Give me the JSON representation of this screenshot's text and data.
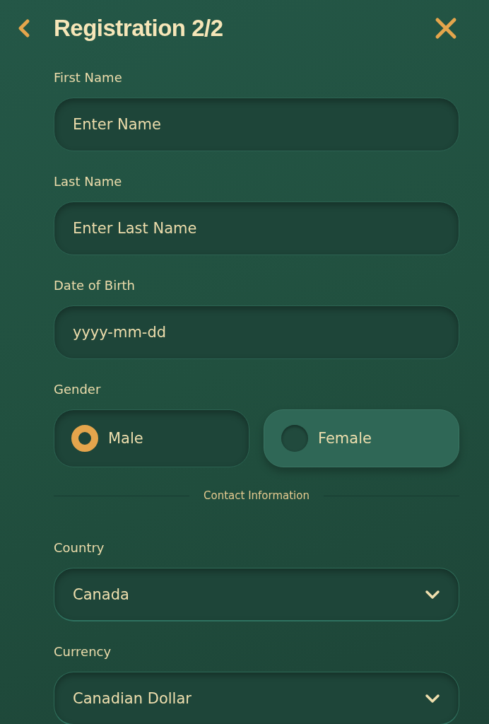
{
  "header": {
    "title": "Registration 2/2"
  },
  "fields": [
    {
      "label": "First Name",
      "placeholder": "Enter Name"
    },
    {
      "label": "Last Name",
      "placeholder": "Enter Last Name"
    },
    {
      "label": "Date of Birth",
      "placeholder": "yyyy-mm-dd"
    }
  ],
  "gender": {
    "label": "Gender",
    "options": [
      {
        "label": "Male",
        "selected": true
      },
      {
        "label": "Female",
        "selected": false
      }
    ]
  },
  "divider": {
    "label": "Contact Information"
  },
  "selects": [
    {
      "label": "Country",
      "value": "Canada"
    },
    {
      "label": "Currency",
      "value": "Canadian Dollar"
    }
  ]
}
